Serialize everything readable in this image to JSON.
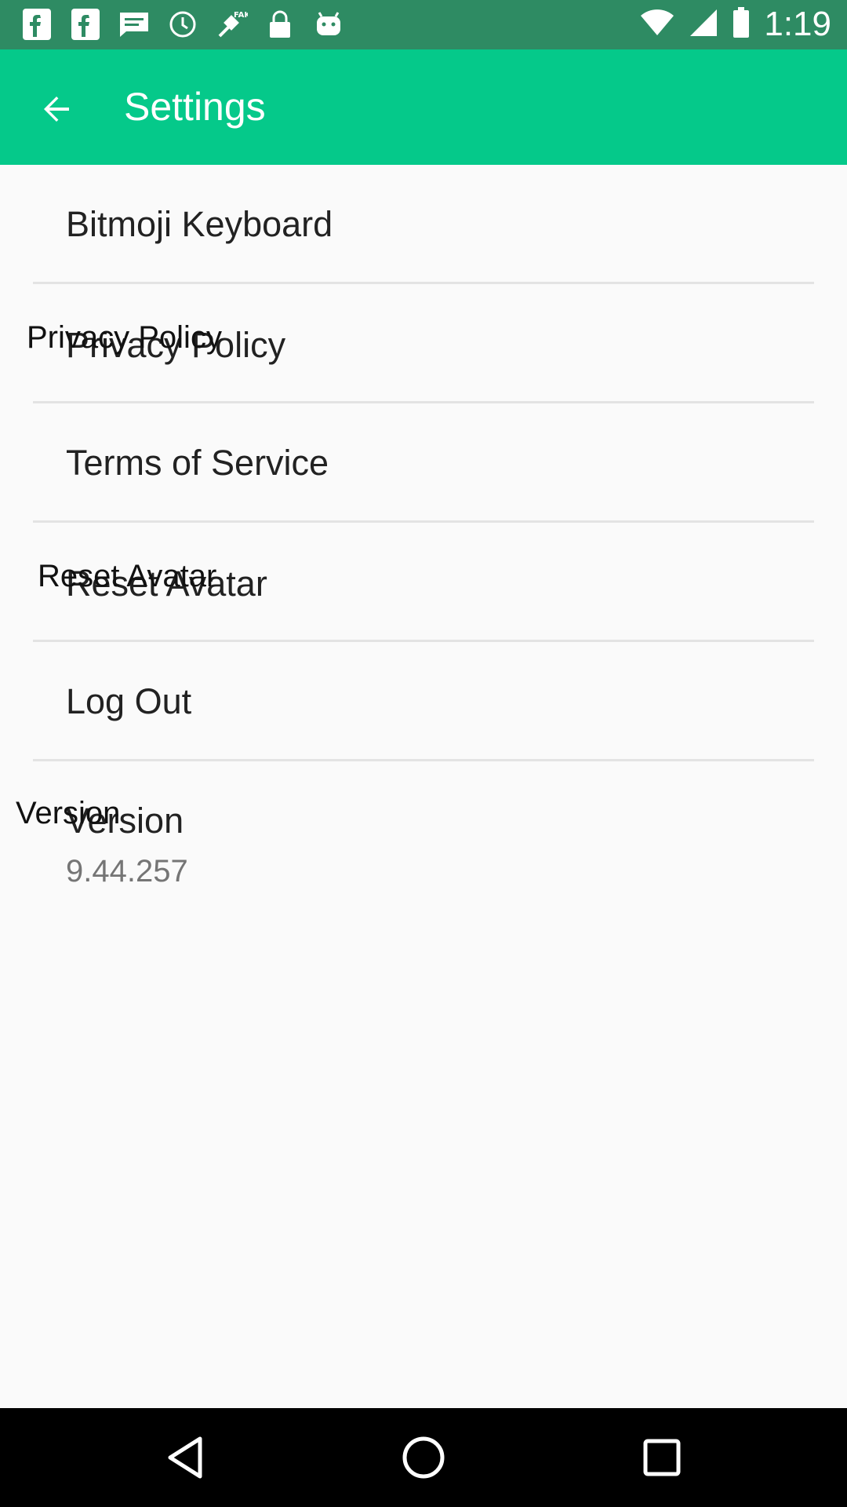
{
  "status_bar": {
    "time": "1:19",
    "left_icons": [
      "f-icon",
      "f-icon",
      "message-icon",
      "clock-icon",
      "fake-gps-icon",
      "lock-icon",
      "android-icon"
    ],
    "right_icons": [
      "wifi-icon",
      "signal-icon",
      "battery-icon"
    ],
    "color": "#2e8b63"
  },
  "app_bar": {
    "title": "Settings",
    "color": "#05c98a"
  },
  "settings": {
    "items": [
      {
        "label": "Bitmoji Keyboard"
      },
      {
        "label": "Privacy Policy",
        "overlay": "Privacy Policy"
      },
      {
        "label": "Terms of Service"
      },
      {
        "label": "Reset Avatar",
        "overlay": "Reset Avatar"
      },
      {
        "label": "Log Out"
      }
    ],
    "version": {
      "label": "Version",
      "overlay": "Version",
      "value": "9.44.257"
    }
  },
  "nav_bar": {
    "buttons": [
      "back-triangle-icon",
      "home-circle-icon",
      "recents-square-icon"
    ]
  }
}
